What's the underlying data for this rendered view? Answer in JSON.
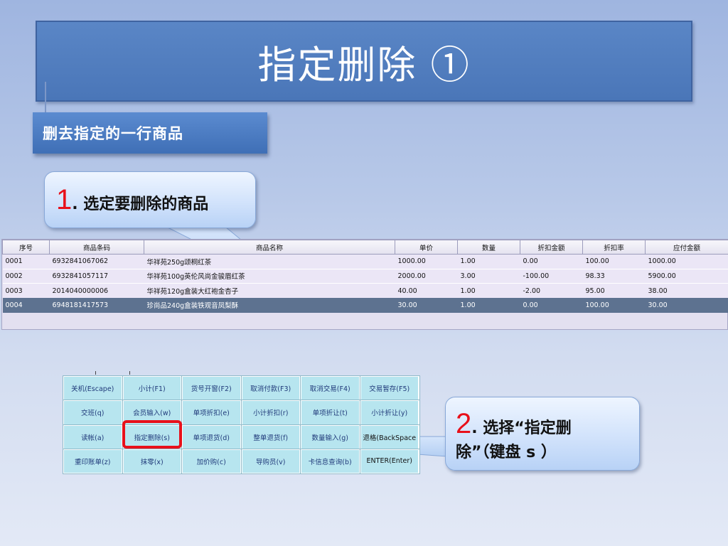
{
  "slide": {
    "title": "指定删除 ①",
    "subtitle": "删去指定的一行商品"
  },
  "callouts": {
    "step1": {
      "number": "1",
      "text": ". 选定要删除的商品"
    },
    "step2": {
      "number": "2",
      "line1": ". 选择“指定删",
      "line2": "除”（键盘 s ）"
    }
  },
  "grid": {
    "headers": [
      "序号",
      "商品条码",
      "商品名称",
      "单价",
      "数量",
      "折扣金额",
      "折扣率",
      "应付金额"
    ],
    "rows": [
      [
        "0001",
        "6932841067062",
        "华祥苑250g颂桐红茶",
        "1000.00",
        "1.00",
        "0.00",
        "100.00",
        "1000.00"
      ],
      [
        "0002",
        "6932841057117",
        "华祥苑100g英伦风尚金骏眉红茶",
        "2000.00",
        "3.00",
        "-100.00",
        "98.33",
        "5900.00"
      ],
      [
        "0003",
        "2014040000006",
        "华祥苑120g盒装大红袍金杏子",
        "40.00",
        "1.00",
        "-2.00",
        "95.00",
        "38.00"
      ],
      [
        "0004",
        "6948181417573",
        "珍尚品240g盒装铁观音凤梨酥",
        "30.00",
        "1.00",
        "0.00",
        "100.00",
        "30.00"
      ]
    ],
    "selected_row": 3
  },
  "keypad": {
    "keys": [
      "关机(Escape)",
      "小计(F1)",
      "货号开窗(F2)",
      "取消付款(F3)",
      "取消交易(F4)",
      "交易暂存(F5)",
      "交班(q)",
      "会员输入(w)",
      "单项折扣(e)",
      "小计折扣(r)",
      "单项折让(t)",
      "小计折让(y)",
      "读帐(a)",
      "指定删除(s)",
      "单项退货(d)",
      "整单退货(f)",
      "数量输入(g)",
      "退格(BackSpace",
      "重印账单(z)",
      "抹零(x)",
      "加价购(c)",
      "导购员(v)",
      "卡信息查询(b)",
      "ENTER(Enter)"
    ]
  },
  "colors": {
    "title_bg": "#4a76b8",
    "accent_red": "#e8101a",
    "selected_row": "#5d7290",
    "key_bg": "#b7e5ef"
  }
}
